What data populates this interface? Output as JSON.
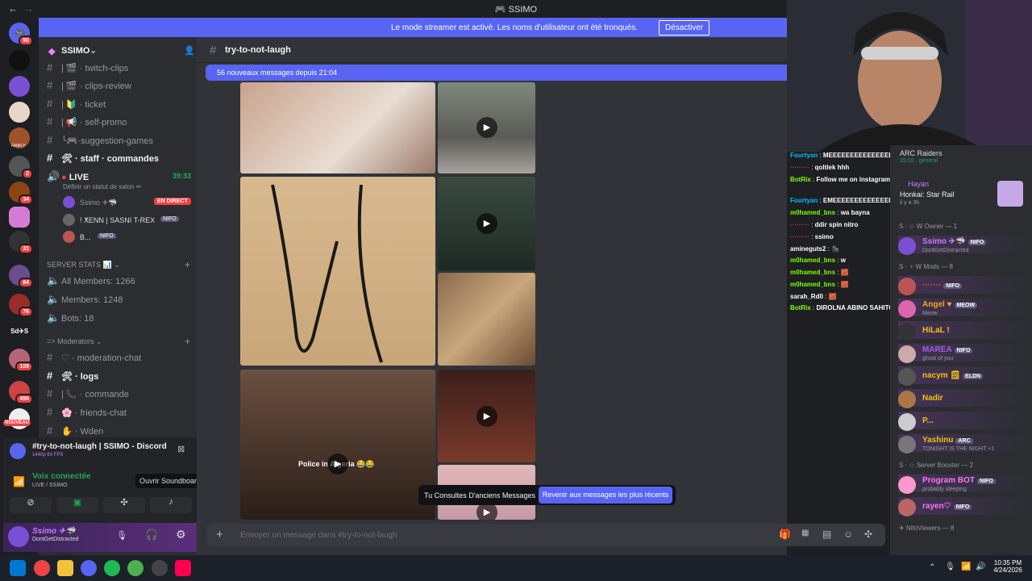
{
  "window": {
    "title": "SSIMO",
    "back": "←",
    "forward": "→"
  },
  "banner": {
    "text": "Le mode streamer est activé. Les noms d'utilisateur ont été tronqués.",
    "button": "Désactiver"
  },
  "rail": {
    "badges": [
      "90",
      "2",
      "34",
      "31",
      "84",
      "76",
      "109",
      "496"
    ],
    "new_label": "NOUVEAU",
    "family_label": "FAMILY",
    "sd_label": "Sd✈S"
  },
  "server": {
    "name": "SSIMO"
  },
  "channels": [
    {
      "name": "twitch-clips",
      "prefix": "| 🎬 ·"
    },
    {
      "name": "clips-review",
      "prefix": "| 🎬 ·"
    },
    {
      "name": "ticket",
      "prefix": "| 🔰 ·"
    },
    {
      "name": "self-promo",
      "prefix": "| 📢 ·"
    },
    {
      "name": "suggestion-games",
      "prefix": "╰🎮·"
    }
  ],
  "staff_channel": {
    "name": "staff · commandes",
    "prefix": "🛠 ·"
  },
  "live": {
    "name": "LIVE",
    "time": "39:33",
    "status": "Définir un statut de salon ✏"
  },
  "voice_users": [
    {
      "name": "Ssimo ✈🦈",
      "tag": "NIFO",
      "live": "EN DIRECT"
    },
    {
      "name": "! ⵅENN | SASNI T-REX",
      "tag": "NIFO"
    },
    {
      "name": "B...",
      "tag": "NIFO"
    }
  ],
  "stats_category": "SERVER STATS 📊",
  "stats": [
    "All Members: 1266",
    "Members: 1248",
    "Bots: 18"
  ],
  "mod_category": "=> Moderators",
  "mod_channels": [
    {
      "name": "moderation-chat",
      "prefix": "♡ ·",
      "bold": false
    },
    {
      "name": "logs",
      "prefix": "🛠 ·",
      "bold": true
    },
    {
      "name": "commande",
      "prefix": "| 📞 ·",
      "bold": false
    },
    {
      "name": "friends-chat",
      "prefix": "🌸 ·",
      "bold": false
    },
    {
      "name": "Wden",
      "prefix": "✋ ·",
      "bold": false
    }
  ],
  "stream_card": {
    "title": "#try-to-not-laugh | SSIMO - Discord",
    "quality": "1440p 60 FPS"
  },
  "voice_connected": {
    "title": "Voix connectée",
    "sub": "LIVE / SSIMO",
    "tooltip": "Ouvrir Soundboard"
  },
  "user": {
    "name": "Ssimo ✈🦈",
    "status": "DontGetDistracted"
  },
  "channel": {
    "name": "try-to-not-laugh",
    "new_messages": "56 nouveaux messages depuis 21:04",
    "composer_placeholder": "Envoyer un message dans #try-to-not-laugh"
  },
  "older": {
    "text": "Tu Consultes D'anciens Messages",
    "button": "Revenir aux messages les plus récents"
  },
  "overlay_text": "Police in Algeria 😂😂",
  "chat": [
    {
      "user": "Fourtyan",
      "msg": "MEEEEEEEEEEEEEEE",
      "color": "#00bfff"
    },
    {
      "user": "·········",
      "msg": "qoltlek hhh",
      "color": "#c0392b"
    },
    {
      "user": "BotRix",
      "msg": "Follow me on instagram https://www.instagram.com/itsssimooo?hl=fr ✨",
      "color": "#7fff00"
    },
    {
      "user": "Fourtyan",
      "msg": "EMEEEEEEEEEEEEEEEEEE",
      "color": "#00bfff"
    },
    {
      "user": "m0hamed_bns",
      "msg": "wa bayna",
      "color": "#7fff00"
    },
    {
      "user": "·········",
      "msg": "ddir spin nitro",
      "color": "#c0392b"
    },
    {
      "user": "·········",
      "msg": "ssimo",
      "color": "#c0392b"
    },
    {
      "user": "amineguts2",
      "msg": "🦍",
      "color": "#ffffff"
    },
    {
      "user": "m0hamed_bns",
      "msg": "w",
      "color": "#7fff00"
    },
    {
      "user": "m0hamed_bns",
      "msg": "🧱",
      "color": "#7fff00"
    },
    {
      "user": "m0hamed_bns",
      "msg": "🧱",
      "color": "#7fff00"
    },
    {
      "user": "sarah_Rd0",
      "msg": "🧱",
      "color": "#ffffff"
    },
    {
      "user": "BotRix",
      "msg": "DIROLNA ABINO SAHITO",
      "color": "#7fff00"
    }
  ],
  "activity": [
    {
      "title": "ARC Raiders",
      "sub": "25:02 · general"
    },
    {
      "title": "Hayan",
      "sub": ""
    },
    {
      "title": "Honkai: Star Rail",
      "sub": "il y a 3h"
    }
  ],
  "member_groups": [
    {
      "header": "S · ☆ W Owner — 1",
      "members": [
        {
          "name": "Ssimo ✈🦈",
          "tag": "NIFO",
          "status": "DontGetDistracted",
          "color": "#c77dff"
        }
      ]
    },
    {
      "header": "S · ♆ W Mods — 8",
      "members": [
        {
          "name": "·······",
          "tag": "NIFO",
          "status": "",
          "color": "#ff3d3d"
        },
        {
          "name": "Angel ♥",
          "tag": "MEOW",
          "status": "Meow",
          "color": "#f5a623"
        },
        {
          "name": "HiLaL !",
          "tag": "",
          "status": "",
          "color": "#f1c40f"
        },
        {
          "name": "MAREA",
          "tag": "NIFO",
          "status": "ghost of you",
          "color": "#a55eea"
        },
        {
          "name": "nacym 🗒",
          "tag": "ELDN",
          "status": "",
          "color": "#f1c40f"
        },
        {
          "name": "Nadir",
          "tag": "",
          "status": "",
          "color": "#f1c40f"
        },
        {
          "name": "P...",
          "tag": "",
          "status": "",
          "color": "#f1c40f"
        },
        {
          "name": "Yashinu",
          "tag": "ARC",
          "status": "TONIGHT IS THE NIGHT +1",
          "color": "#f1c40f"
        }
      ]
    },
    {
      "header": "S · ☆ Server Booster — 2",
      "members": [
        {
          "name": "Program BOT",
          "tag": "NIFO",
          "status": "probably sleeping",
          "color": "#ff73fa"
        },
        {
          "name": "rayen♡",
          "tag": "NIFO",
          "status": "",
          "color": "#ff73fa"
        }
      ]
    },
    {
      "header": "✈ NifoViewers — 8",
      "members": []
    }
  ],
  "clock": {
    "time": "10:35 PM",
    "date": "4/24/2026"
  },
  "colors": {
    "blurple": "#5865f2",
    "bg": "#313338",
    "sidebar": "#2b2d31",
    "red": "#f23f43",
    "green": "#23a55a"
  }
}
